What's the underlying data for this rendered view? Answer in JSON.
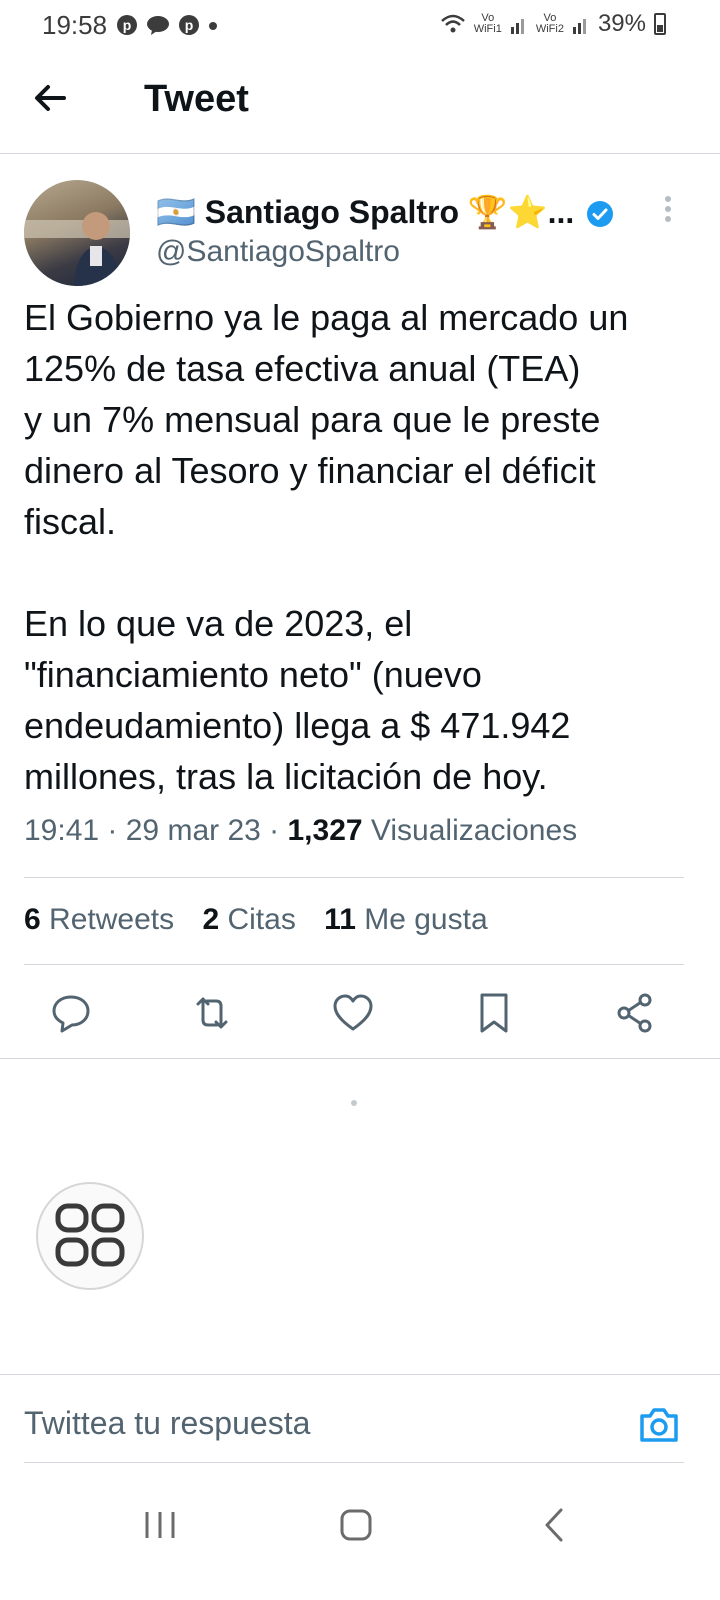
{
  "status_bar": {
    "time": "19:58",
    "notification_icons": [
      "pinterest-icon",
      "chat-icon",
      "pinterest-icon",
      "dot-icon"
    ],
    "wifi1_label": "Vo\nWiFi1",
    "wifi2_label": "Vo\nWiFi2",
    "battery": "39%"
  },
  "header": {
    "title": "Tweet"
  },
  "tweet": {
    "author_flag": "🇦🇷",
    "author_name": "Santiago Spaltro",
    "author_emojis": "🏆⭐...",
    "handle": "@SantiagoSpaltro",
    "text": "El Gobierno ya le paga al mercado un\n125% de tasa efectiva anual (TEA)\ny un 7% mensual para que le preste\ndinero al Tesoro y financiar el déficit\nfiscal.\n\nEn lo que va de 2023, el\n\"financiamiento neto\" (nuevo\nendeudamiento) llega a $ 471.942\nmillones, tras la licitación de hoy.",
    "time": "19:41",
    "date": "29 mar 23",
    "views": "1,327",
    "views_label": "Visualizaciones",
    "retweets": "6",
    "retweets_label": "Retweets",
    "quotes": "2",
    "quotes_label": "Citas",
    "likes": "11",
    "likes_label": "Me gusta"
  },
  "reply": {
    "placeholder": "Twittea tu respuesta"
  },
  "colors": {
    "accent": "#1d9bf0",
    "text": "#0f1419",
    "secondary": "#536471",
    "divider": "#d3d7dc"
  }
}
